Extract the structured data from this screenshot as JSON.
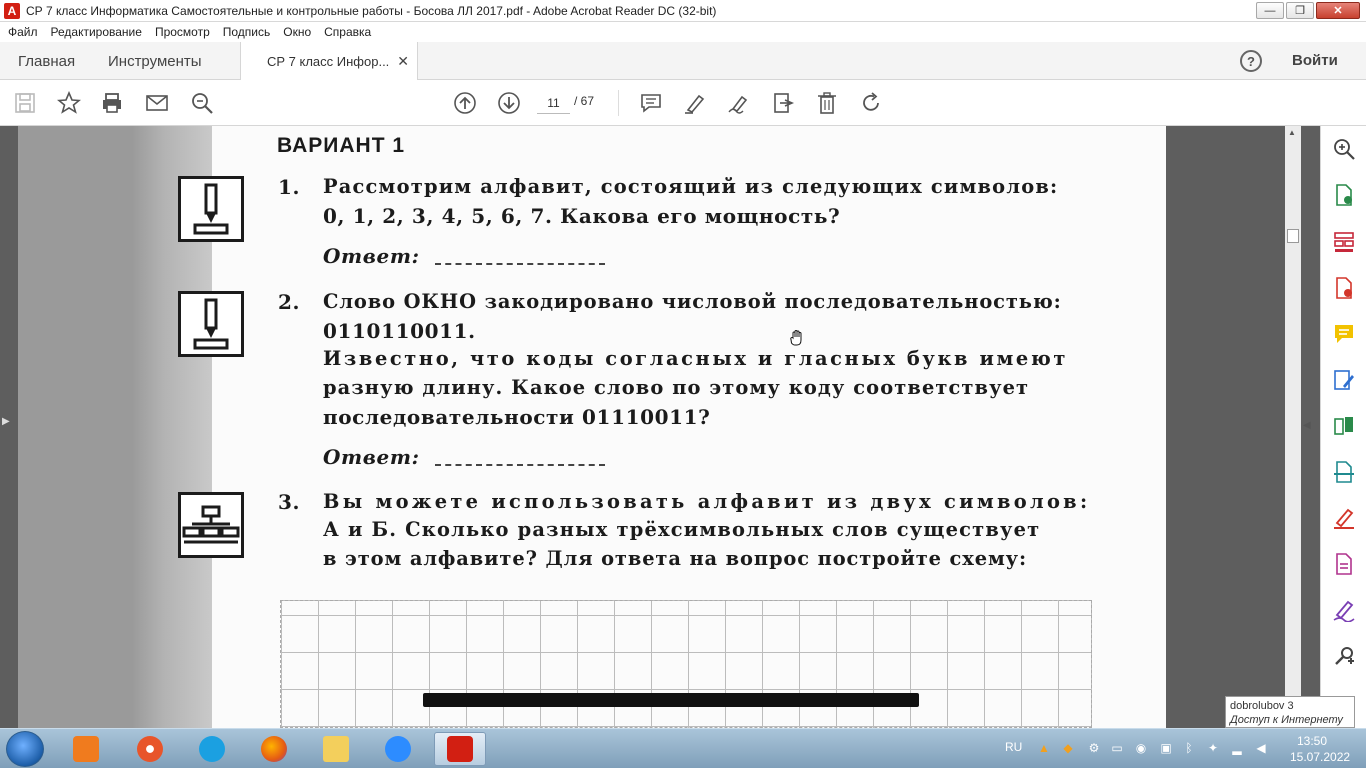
{
  "window": {
    "title": "СР 7 класс Информатика Самостоятельные и контрольные работы - Босова ЛЛ 2017.pdf - Adobe Acrobat Reader DC (32-bit)",
    "app_icon_letter": "A",
    "minimize": "—",
    "maximize": "❐",
    "close": "✕"
  },
  "menu": [
    "Файл",
    "Редактирование",
    "Просмотр",
    "Подпись",
    "Окно",
    "Справка"
  ],
  "tabs": {
    "home": "Главная",
    "tools": "Инструменты",
    "document": "СР 7 класс Инфор...",
    "document_close": "✕",
    "help": "?",
    "sign_in": "Войти"
  },
  "toolbar": {
    "current_page": "11",
    "total_pages": "/ 67",
    "icons": [
      "save-icon",
      "bookmark-star-icon",
      "print-icon",
      "email-icon",
      "zoom-search-icon",
      "page-up-icon",
      "page-down-icon",
      "comment-icon",
      "highlight-pen-icon",
      "sign-icon",
      "export-icon",
      "delete-icon",
      "rotate-icon"
    ]
  },
  "document": {
    "variant": "ВАРИАНТ  1",
    "q1": {
      "number": "1.",
      "line1": "Рассмотрим алфавит, состоящий из следующих символов:",
      "line2": "0, 1, 2, 3, 4, 5, 6, 7. Какова его мощность?",
      "answer_label": "Ответ:"
    },
    "q2": {
      "number": "2.",
      "line1": "Слово ОКНО закодировано числовой последовательностью:",
      "line2": "0110110011.",
      "line3": "Известно, что коды согласных и гласных букв имеют",
      "line4": "разную длину. Какое слово по этому коду соответствует",
      "line5": "последовательности 01110011?",
      "answer_label": "Ответ:"
    },
    "q3": {
      "number": "3.",
      "line1": "Вы можете использовать алфавит из двух символов:",
      "line2": "А и Б. Сколько разных трёхсимвольных слов существует",
      "line3": "в этом алфавите? Для ответа на вопрос постройте схему:"
    }
  },
  "right_tools": [
    "zoom-icon",
    "create-pdf-icon",
    "organize-pages-icon",
    "export-pdf-icon",
    "comment-icon",
    "edit-pdf-icon",
    "combine-icon",
    "scan-icon",
    "fill-sign-icon",
    "protect-icon",
    "send-for-signature-icon",
    "more-tools-icon"
  ],
  "tooltip": {
    "line1": "dobrolubov  3",
    "line2": "Доступ к Интернету"
  },
  "taskbar": {
    "language": "RU",
    "time": "13:50",
    "date": "15.07.2022"
  },
  "colors": {
    "acrobat_red": "#d21f12",
    "taskbar": "#8fb0c9",
    "page_bg": "#fbfbfb"
  }
}
